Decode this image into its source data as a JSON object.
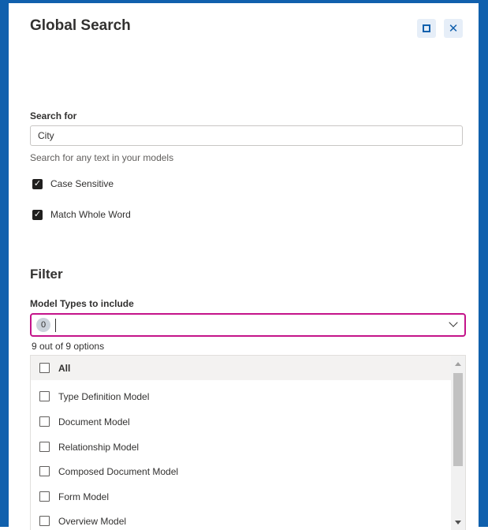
{
  "dialog": {
    "title": "Global Search",
    "expand_icon": "expand-icon",
    "close_icon": "close-icon",
    "close_glyph": "✕"
  },
  "search": {
    "label": "Search for",
    "value": "City",
    "hint": "Search for any text in your models"
  },
  "options": {
    "case_sensitive": {
      "label": "Case Sensitive",
      "checked": true
    },
    "match_whole_word": {
      "label": "Match Whole Word",
      "checked": true
    }
  },
  "filter": {
    "title": "Filter",
    "model_types_label": "Model Types to include",
    "selected_count": "0",
    "options_count_text": "9 out of 9 options",
    "items": [
      {
        "label": "All",
        "checked": false
      },
      {
        "label": "Type Definition Model",
        "checked": false
      },
      {
        "label": "Document Model",
        "checked": false
      },
      {
        "label": "Relationship Model",
        "checked": false
      },
      {
        "label": "Composed Document Model",
        "checked": false
      },
      {
        "label": "Form Model",
        "checked": false
      },
      {
        "label": "Overview Model",
        "checked": false
      }
    ]
  },
  "colors": {
    "frame": "#1060ad",
    "focus_border": "#c4148a",
    "badge": "#cbd2db"
  }
}
